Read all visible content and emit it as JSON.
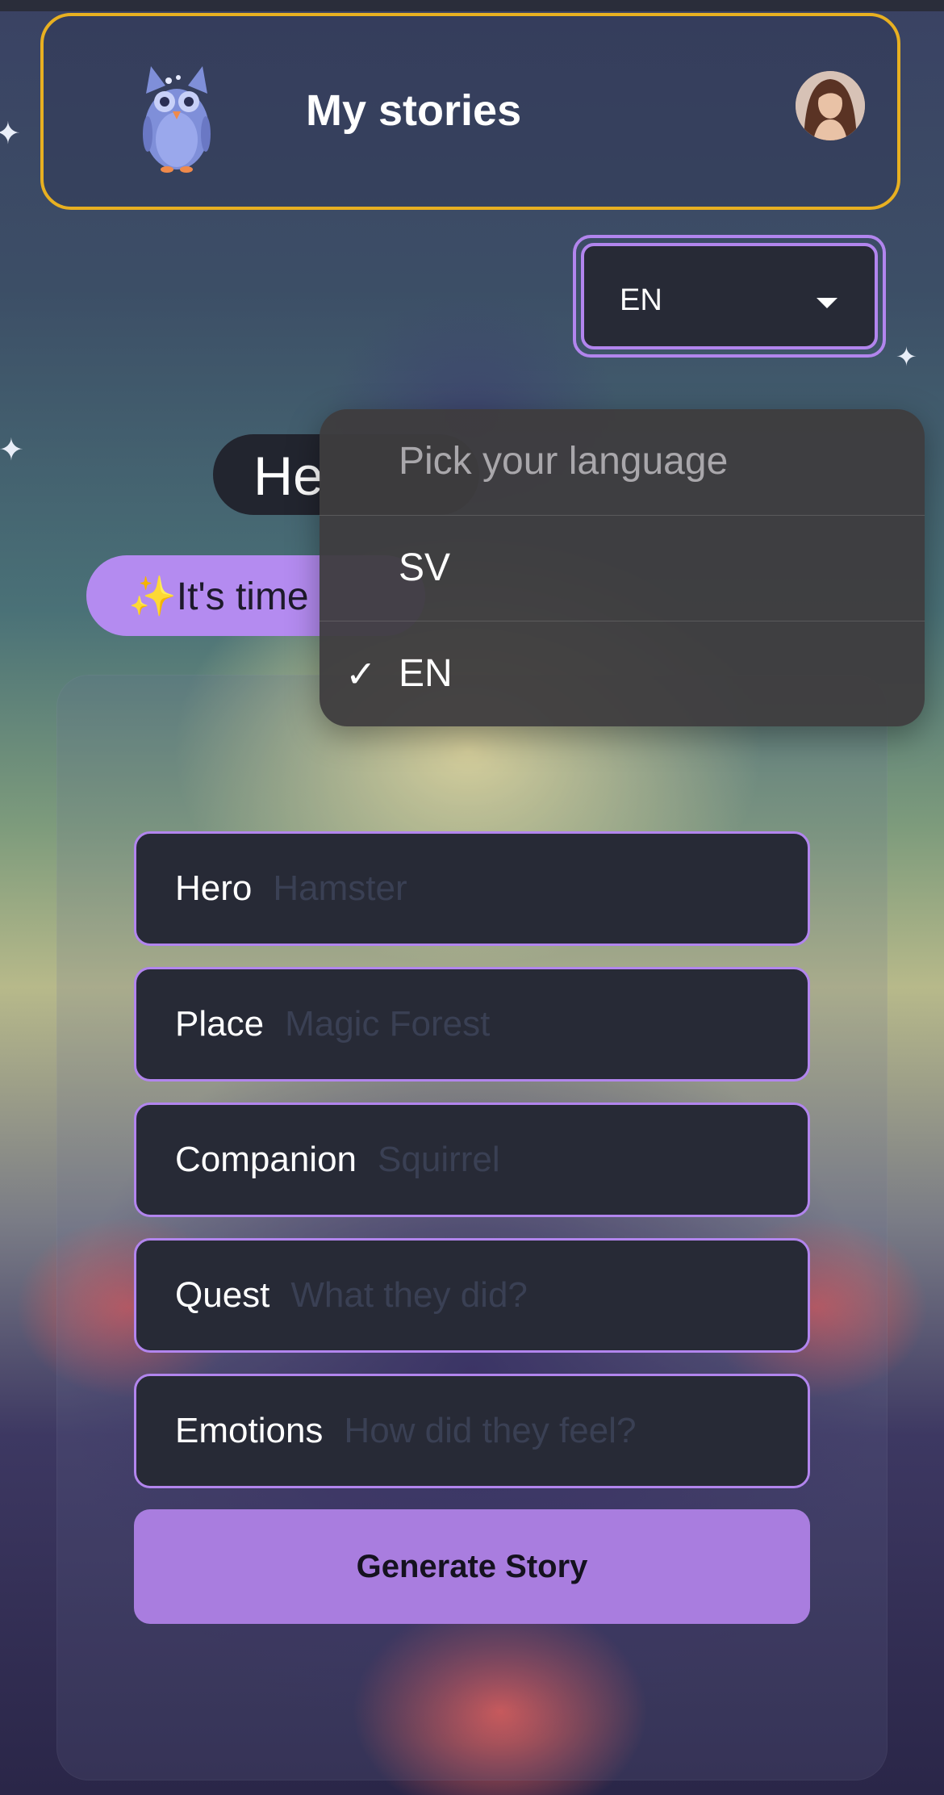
{
  "header": {
    "title": "My stories",
    "logo": "owl-logo",
    "avatar": "user-avatar"
  },
  "language_select": {
    "value": "EN",
    "icon": "chevron-down-icon"
  },
  "hero_section": {
    "greeting": "He",
    "subtitle": "✨It's time"
  },
  "form": {
    "fields": [
      {
        "label": "Hero",
        "placeholder": "Hamster",
        "value": ""
      },
      {
        "label": "Place",
        "placeholder": "Magic Forest",
        "value": ""
      },
      {
        "label": "Companion",
        "placeholder": "Squirrel",
        "value": ""
      },
      {
        "label": "Quest",
        "placeholder": "What they did?",
        "value": ""
      },
      {
        "label": "Emotions",
        "placeholder": "How did they feel?",
        "value": ""
      }
    ],
    "submit_label": "Generate Story"
  },
  "language_dropdown": {
    "header": "Pick your language",
    "options": [
      {
        "label": "SV",
        "selected": false
      },
      {
        "label": "EN",
        "selected": true
      }
    ],
    "check_icon": "checkmark-icon"
  },
  "colors": {
    "header_border": "#e8b021",
    "accent_purple": "#b285ee",
    "button_purple": "#a97ddf",
    "field_background": "#272a36"
  }
}
